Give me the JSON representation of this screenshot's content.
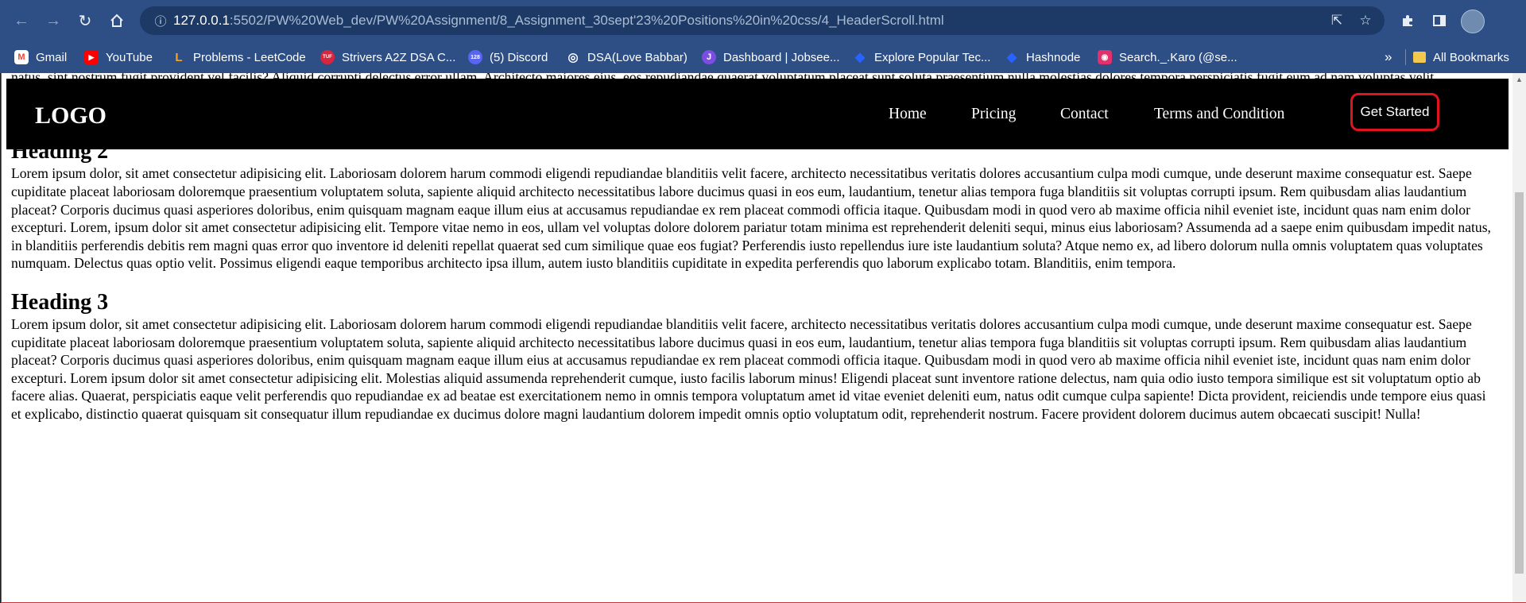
{
  "browser": {
    "url_host": "127.0.0.1",
    "url_rest": ":5502/PW%20Web_dev/PW%20Assignment/8_Assignment_30sept'23%20Positions%20in%20css/4_HeaderScroll.html",
    "icons": {
      "back": "arrow-left-icon",
      "forward": "arrow-right-icon",
      "reload": "reload-icon",
      "home": "home-icon",
      "site_info": "site-info-icon",
      "share": "share-icon",
      "bookmark_star": "star-icon",
      "extensions": "puzzle-icon",
      "side_panel": "side-panel-icon",
      "profile": "avatar"
    }
  },
  "bookmarks": {
    "items": [
      {
        "label": "Gmail",
        "color": "#ea4335",
        "glyph": "M"
      },
      {
        "label": "YouTube",
        "color": "#ff0000",
        "glyph": "▶"
      },
      {
        "label": "Problems - LeetCode",
        "color": "#f5a623",
        "glyph": "L"
      },
      {
        "label": "Strivers A2Z DSA C...",
        "color": "#d7263d",
        "glyph": "TUF"
      },
      {
        "label": "(5) Discord",
        "color": "#5865f2",
        "glyph": "128"
      },
      {
        "label": "DSA(Love Babbar)",
        "color": "#ffffff",
        "glyph": "◎"
      },
      {
        "label": "Dashboard | Jobsee...",
        "color": "#7b4de0",
        "glyph": "J"
      },
      {
        "label": "Explore Popular Tec...",
        "color": "#2962ff",
        "glyph": "◆"
      },
      {
        "label": "Hashnode",
        "color": "#2962ff",
        "glyph": "◆"
      },
      {
        "label": "Search._.Karo (@se...",
        "color": "#e1306c",
        "glyph": "◉"
      }
    ],
    "overflow": "»",
    "all_bookmarks": "All Bookmarks"
  },
  "page": {
    "header": {
      "logo": "LOGO",
      "nav": [
        "Home",
        "Pricing",
        "Contact",
        "Terms and Condition"
      ],
      "cta": "Get Started"
    },
    "intro_paragraph": "modi in quod vero ab maxime officia nihil eveniet iste, incidunt quas nam enim dolor excepturi. Lorem ipsum dolor sit, amet consectetur adipisicing elit. Consequatur dolore natus quis corporis ut possimus? Minima, ab. Aut, vitae. Tenetur praesentium doloribus natus, sint nostrum fugit provident vel facilis? Aliquid corrupti delectus error ullam. Architecto maiores eius, eos repudiandae quaerat voluptatum placeat sunt soluta praesentium nulla molestias dolores tempora perspiciatis fugit eum ad nam voluptas velit. Dignissimos earum tempora repudiandae sed distinctio laborum, deserunt voluptatibus voluptatem blanditiis fugiat, quidem esse consequatur ratione porro aperiam non sunt ipsum sit quam, dolorem unde? Magni assumenda ut incidunt dolorem sapiente harum id et cumque nostrum officiis, explicabo autem temporibus ipsam possimus repellendus nobis!",
    "sections": [
      {
        "heading": "Heading 2",
        "text": "Lorem ipsum dolor, sit amet consectetur adipisicing elit. Laboriosam dolorem harum commodi eligendi repudiandae blanditiis velit facere, architecto necessitatibus veritatis dolores accusantium culpa modi cumque, unde deserunt maxime consequatur est. Saepe cupiditate placeat laboriosam doloremque praesentium voluptatem soluta, sapiente aliquid architecto necessitatibus labore ducimus quasi in eos eum, laudantium, tenetur alias tempora fuga blanditiis sit voluptas corrupti ipsum. Rem quibusdam alias laudantium placeat? Corporis ducimus quasi asperiores doloribus, enim quisquam magnam eaque illum eius at accusamus repudiandae ex rem placeat commodi officia itaque. Quibusdam modi in quod vero ab maxime officia nihil eveniet iste, incidunt quas nam enim dolor excepturi. Lorem, ipsum dolor sit amet consectetur adipisicing elit. Tempore vitae nemo in eos, ullam vel voluptas dolore dolorem pariatur totam minima est reprehenderit deleniti sequi, minus eius laboriosam? Assumenda ad a saepe enim quibusdam impedit natus, in blanditiis perferendis debitis rem magni quas error quo inventore id deleniti repellat quaerat sed cum similique quae eos fugiat? Perferendis iusto repellendus iure iste laudantium soluta? Atque nemo ex, ad libero dolorum nulla omnis voluptatem quas voluptates numquam. Delectus quas optio velit. Possimus eligendi eaque temporibus architecto ipsa illum, autem iusto blanditiis cupiditate in expedita perferendis quo laborum explicabo totam. Blanditiis, enim tempora."
      },
      {
        "heading": "Heading 3",
        "text": "Lorem ipsum dolor, sit amet consectetur adipisicing elit. Laboriosam dolorem harum commodi eligendi repudiandae blanditiis velit facere, architecto necessitatibus veritatis dolores accusantium culpa modi cumque, unde deserunt maxime consequatur est. Saepe cupiditate placeat laboriosam doloremque praesentium voluptatem soluta, sapiente aliquid architecto necessitatibus labore ducimus quasi in eos eum, laudantium, tenetur alias tempora fuga blanditiis sit voluptas corrupti ipsum. Rem quibusdam alias laudantium placeat? Corporis ducimus quasi asperiores doloribus, enim quisquam magnam eaque illum eius at accusamus repudiandae ex rem placeat commodi officia itaque. Quibusdam modi in quod vero ab maxime officia nihil eveniet iste, incidunt quas nam enim dolor excepturi. Lorem ipsum dolor sit amet consectetur adipisicing elit. Molestias aliquid assumenda reprehenderit cumque, iusto facilis laborum minus! Eligendi placeat sunt inventore ratione delectus, nam quia odio iusto tempora similique est sit voluptatum optio ab facere alias. Quaerat, perspiciatis eaque velit perferendis quo repudiandae ex ad beatae est exercitationem nemo in omnis tempora voluptatum amet id vitae eveniet deleniti eum, natus odit cumque culpa sapiente! Dicta provident, reiciendis unde tempore eius quasi et explicabo, distinctio quaerat quisquam sit consequatur illum repudiandae ex ducimus dolore magni laudantium dolorem impedit omnis optio voluptatum odit, reprehenderit nostrum. Facere provident dolorem ducimus autem obcaecati suscipit! Nulla!"
      }
    ]
  },
  "colors": {
    "chrome_toolbar": "#2d4f86",
    "omnibox": "#1d3a66",
    "header_bg": "#000000",
    "cta_border": "#e0141e"
  }
}
